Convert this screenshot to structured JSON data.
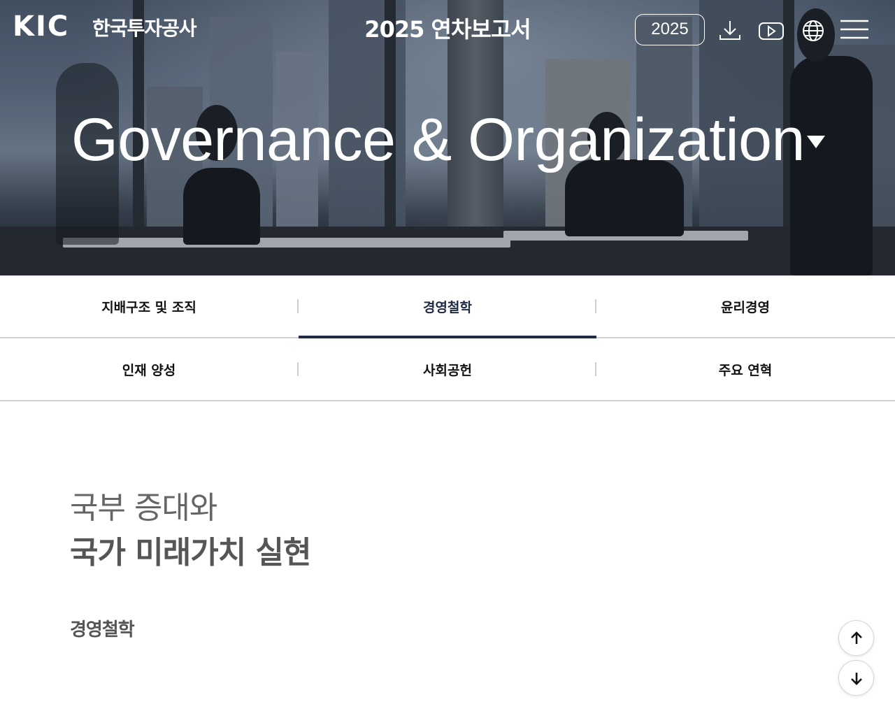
{
  "header": {
    "logo_mark": "KIC",
    "logo_text": "한국투자공사",
    "report_title": "2025 연차보고서",
    "year_button": "2025",
    "icons": [
      "download-icon",
      "youtube-icon",
      "globe-icon",
      "menu-icon"
    ]
  },
  "hero": {
    "heading": "Governance & Organization",
    "dropdown_icon": "caret-down-icon"
  },
  "tabs": [
    {
      "label": "지배구조 및 조직",
      "active": false
    },
    {
      "label": "경영철학",
      "active": true
    },
    {
      "label": "윤리경영",
      "active": false
    },
    {
      "label": "인재 양성",
      "active": false
    },
    {
      "label": "사회공헌",
      "active": false
    },
    {
      "label": "주요 연혁",
      "active": false
    }
  ],
  "content": {
    "subtitle": "국부 증대와",
    "title": "국가 미래가치 실현",
    "section_label": "경영철학"
  },
  "scroll": {
    "up_icon": "arrow-up-icon",
    "down_icon": "arrow-down-icon"
  },
  "colors": {
    "accent": "#1f2a44",
    "tab_divider": "#d3d3d3",
    "hero_text": "#ffffff"
  }
}
